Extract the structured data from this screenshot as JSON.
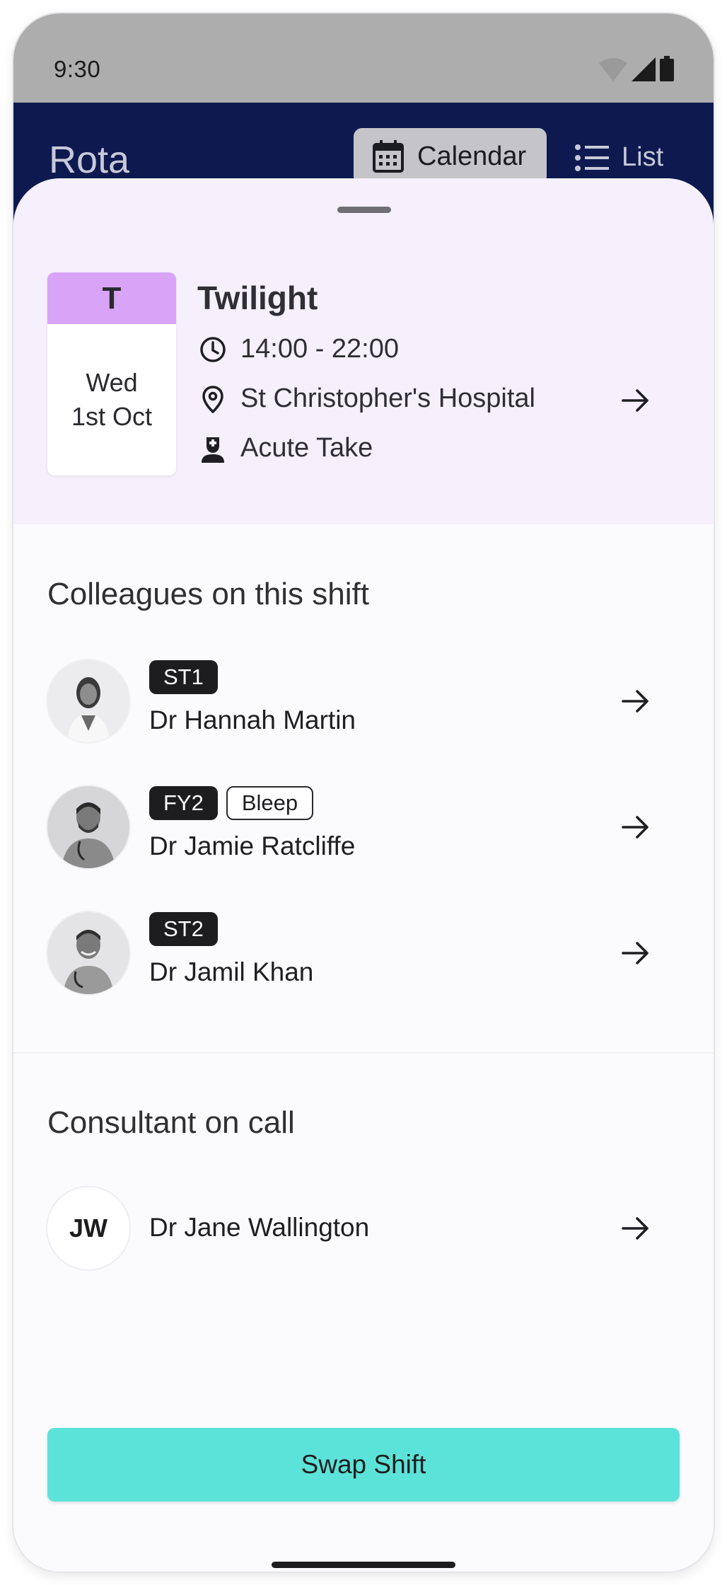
{
  "status": {
    "time": "9:30"
  },
  "appbar": {
    "title": "Rota",
    "calendar_label": "Calendar",
    "list_label": "List"
  },
  "shift": {
    "code": "T",
    "day": "Wed",
    "date": "1st Oct",
    "name": "Twilight",
    "time": "14:00 - 22:00",
    "location": "St Christopher's Hospital",
    "role": "Acute Take",
    "code_color": "#d9a4f8"
  },
  "colleagues": {
    "title": "Colleagues on this shift",
    "items": [
      {
        "name": "Dr Hannah Martin",
        "tags": [
          "ST1"
        ]
      },
      {
        "name": "Dr Jamie Ratcliffe",
        "tags": [
          "FY2",
          "Bleep"
        ]
      },
      {
        "name": "Dr Jamil Khan",
        "tags": [
          "ST2"
        ]
      }
    ]
  },
  "consultant": {
    "title": "Consultant on call",
    "initials": "JW",
    "name": "Dr Jane Wallington"
  },
  "actions": {
    "swap_label": "Swap Shift",
    "swap_color": "#5ce3d9"
  },
  "colors": {
    "appbar": "#0e1a4f",
    "statusbar": "#adadad",
    "shift_bg": "#f5f0fc"
  }
}
